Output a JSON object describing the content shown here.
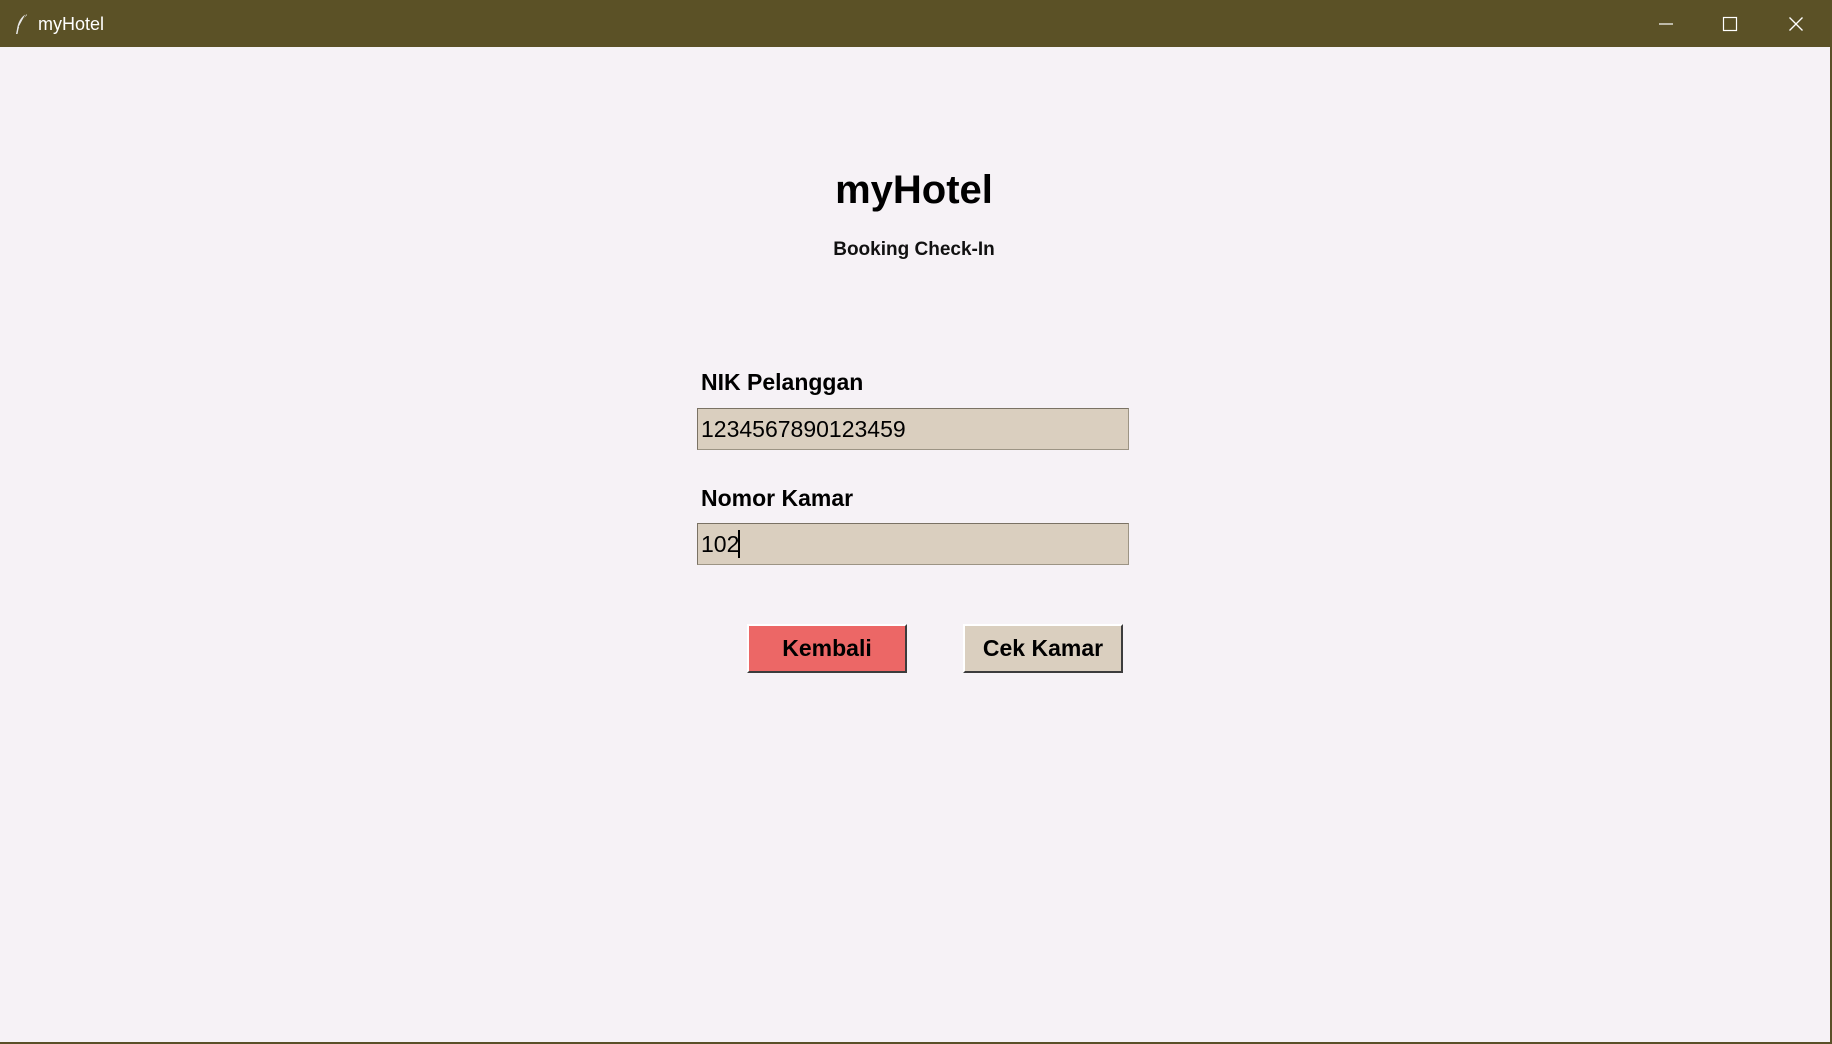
{
  "window": {
    "title": "myHotel",
    "app_icon": "feather-icon",
    "controls": {
      "minimize_icon": "minimize-icon",
      "maximize_icon": "maximize-icon",
      "close_icon": "close-icon"
    },
    "titlebar_color": "#5b5126"
  },
  "header": {
    "title": "myHotel",
    "subtitle": "Booking Check-In"
  },
  "form": {
    "nik": {
      "label": "NIK Pelanggan",
      "value": "1234567890123459"
    },
    "kamar": {
      "label": "Nomor Kamar",
      "value": "102"
    }
  },
  "buttons": {
    "back_label": "Kembali",
    "check_label": "Cek Kamar",
    "back_color": "#ec6766",
    "check_color": "#dacfbf"
  }
}
